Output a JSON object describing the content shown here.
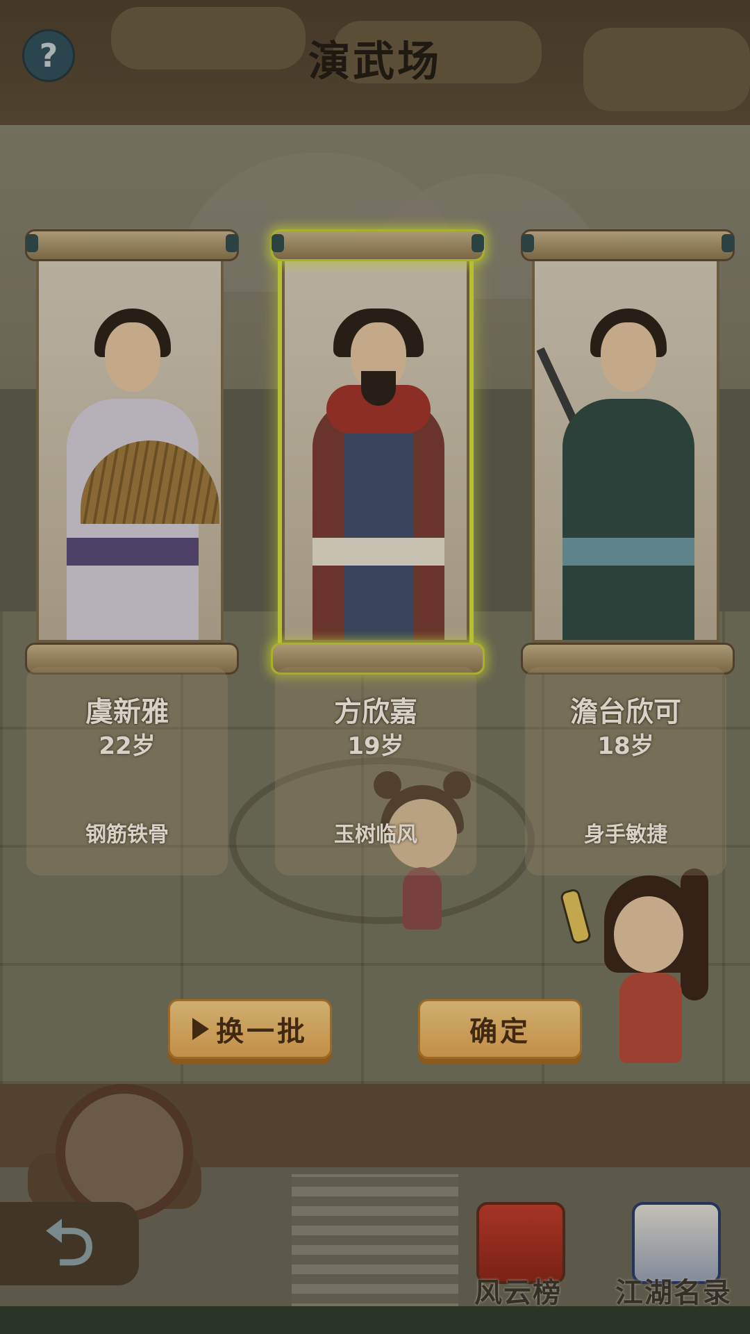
{
  "header": {
    "title": "演武场",
    "help_symbol": "?"
  },
  "candidates": [
    {
      "name": "虞新雅",
      "age": "22岁",
      "trait": "钢筋铁骨",
      "selected": false
    },
    {
      "name": "方欣嘉",
      "age": "19岁",
      "trait": "玉树临风",
      "selected": true
    },
    {
      "name": "澹台欣可",
      "age": "18岁",
      "trait": "身手敏捷",
      "selected": false
    }
  ],
  "actions": {
    "refresh_label": "换一批",
    "confirm_label": "确定"
  },
  "bottom_nav": {
    "back_icon": "back-arrow-icon",
    "items": [
      {
        "label": "风云榜"
      },
      {
        "label": "江湖名录"
      }
    ]
  },
  "colors": {
    "selected_glow": "#d7e43a",
    "button": "#f0b865",
    "title": "#1f1a12"
  }
}
